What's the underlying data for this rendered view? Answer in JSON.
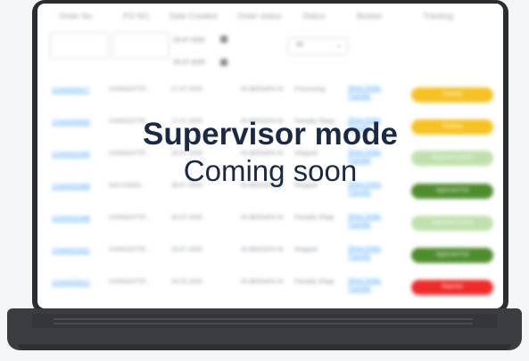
{
  "overlay": {
    "title": "Supervisor mode",
    "subtitle": "Coming soon"
  },
  "table": {
    "headers": [
      "Order No.",
      "PO NO.",
      "Date Created",
      "Order status",
      "Status",
      "Booker",
      "Tracking"
    ],
    "filters": {
      "date_from": "25-07-2025",
      "date_to": "25-07-2025",
      "select": "All"
    },
    "rows": [
      {
        "order_no": "14184200477",
        "po_no": "CHINGOTTE...",
        "date": "27.07.2025",
        "order_status": "IN BERGEN IN",
        "status": "Processing",
        "booker": "Show Order Transfer",
        "tracking": "Pending"
      },
      {
        "order_no": "14184209458",
        "po_no": "CHINGOTTE...",
        "date": "17.07.2025",
        "order_status": "IN BERGEN IN",
        "status": "Partially Shipp",
        "booker": "Show Order Transfer",
        "tracking": "Pending"
      },
      {
        "order_no": "14184201945",
        "po_no": "CHINGOTTE...",
        "date": "28.07.2025",
        "order_status": "IN BERGEN IN",
        "status": "Shipped",
        "booker": "Show Order Transfer",
        "tracking": "Approved Cancel"
      },
      {
        "order_no": "14184201688",
        "po_no": "N/A CHING...",
        "date": "08.07.2025",
        "order_status": "IN BERGEN IN",
        "status": "Shipped",
        "booker": "Show Order Transfer",
        "tracking": "Approved Full"
      },
      {
        "order_no": "14184202496",
        "po_no": "CHINGOTTE...",
        "date": "30.07.2025",
        "order_status": "IN BERGEN IN",
        "status": "Partially Shipp",
        "booker": "Show Order Transfer",
        "tracking": "Approved Cancel"
      },
      {
        "order_no": "14184201821",
        "po_no": "CHINGOTTE...",
        "date": "28.07.2025",
        "order_status": "IN BERGEN IN",
        "status": "Shipped",
        "booker": "Show Order Transfer",
        "tracking": "Approved Full"
      },
      {
        "order_no": "14184200512",
        "po_no": "CHINGOTTE...",
        "date": "24.05.2025",
        "order_status": "IN BERGEN IN",
        "status": "Partially Shipp",
        "booker": "Show Order Transfer",
        "tracking": "Rejected"
      }
    ]
  },
  "colors": {
    "pending": "#f5c225",
    "approved_cancel": "#bfe0ad",
    "approved_full": "#4f8c2e",
    "rejected": "#ef2b2b",
    "title_text": "#1c2942"
  }
}
